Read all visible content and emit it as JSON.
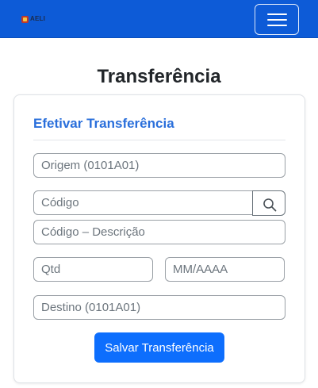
{
  "navbar": {
    "brand_text": "AELI",
    "brand_sub": "",
    "toggle_icon": "hamburger-menu-icon",
    "color": "#0d5bd7"
  },
  "page": {
    "title": "Transferência"
  },
  "card": {
    "title": "Efetivar Transferência",
    "title_color": "#2a6fdb"
  },
  "form": {
    "origem": {
      "value": "",
      "placeholder": "Origem (0101A01)"
    },
    "codigo": {
      "value": "",
      "placeholder": "Código"
    },
    "search_icon": "search-icon",
    "descricao": {
      "value": "",
      "placeholder": "Código – Descrição"
    },
    "qtd": {
      "value": "",
      "placeholder": "Qtd"
    },
    "mes_ano": {
      "value": "",
      "placeholder": "MM/AAAA"
    },
    "destino": {
      "value": "",
      "placeholder": "Destino (0101A01)"
    },
    "save_label": "Salvar Transferência",
    "save_color": "#0d6efd"
  }
}
